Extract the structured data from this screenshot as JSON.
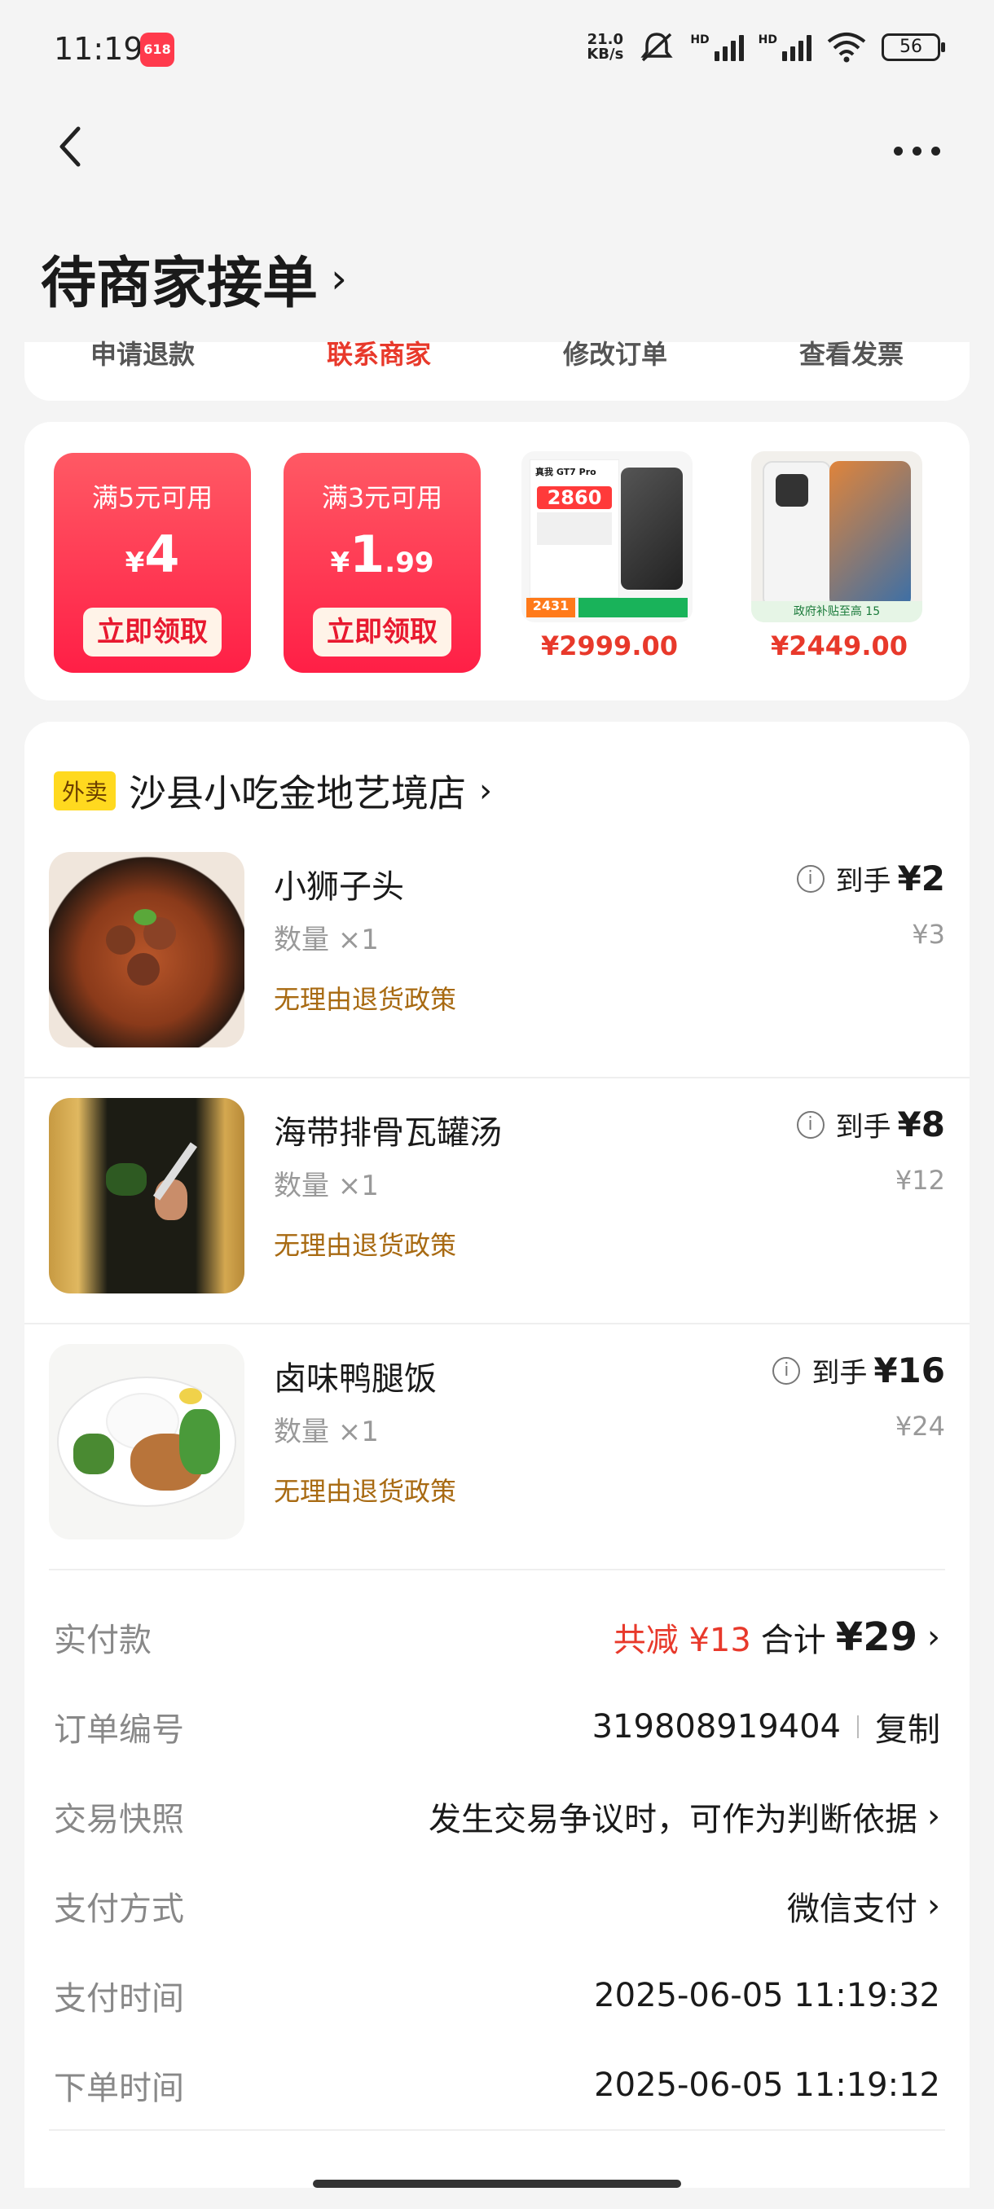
{
  "status_bar": {
    "time": "11:19",
    "app_badge": "618",
    "net_speed_top": "21.0",
    "net_speed_bottom": "KB/s",
    "hd1": "HD",
    "hd2": "HD",
    "battery": "56"
  },
  "header": {
    "title": "待商家接单",
    "title_chevron": "›"
  },
  "actions": [
    {
      "label": "申请退款"
    },
    {
      "label": "联系商家"
    },
    {
      "label": "修改订单"
    },
    {
      "label": "查看发票"
    }
  ],
  "promo": {
    "coupons": [
      {
        "condition": "满5元可用",
        "currency": "¥",
        "amount": "4",
        "button": "立即领取"
      },
      {
        "condition": "满3元可用",
        "currency": "¥",
        "amount": "1",
        "amount_decimal": ".99",
        "button": "立即领取"
      }
    ],
    "products": [
      {
        "price": "¥2999.00",
        "img_text_1": "真我 GT7 Pro",
        "img_text_2": "2860",
        "img_text_3": "2431"
      },
      {
        "price": "¥2449.00",
        "img_text_1": "政府补贴至高 15"
      }
    ]
  },
  "order": {
    "shop_tag": "外卖",
    "shop_name": "沙县小吃金地艺境店",
    "shop_chevron": "›",
    "items": [
      {
        "name": "小狮子头",
        "qty": "数量 ×1",
        "policy": "无理由退货政策",
        "final_label": "到手",
        "final_price": "¥2",
        "orig_price": "¥3"
      },
      {
        "name": "海带排骨瓦罐汤",
        "qty": "数量 ×1",
        "policy": "无理由退货政策",
        "final_label": "到手",
        "final_price": "¥8",
        "orig_price": "¥12"
      },
      {
        "name": "卤味鸭腿饭",
        "qty": "数量 ×1",
        "policy": "无理由退货政策",
        "final_label": "到手",
        "final_price": "¥16",
        "orig_price": "¥24"
      }
    ],
    "summary": {
      "paid_label": "实付款",
      "discount": "共减 ¥13",
      "total_label": "合计",
      "total": "¥29",
      "order_no_label": "订单编号",
      "order_no": "319808919404",
      "copy": "复制",
      "snapshot_label": "交易快照",
      "snapshot_value": "发生交易争议时，可作为判断依据",
      "pay_method_label": "支付方式",
      "pay_method": "微信支付",
      "pay_time_label": "支付时间",
      "pay_time": "2025-06-05 11:19:32",
      "order_time_label": "下单时间",
      "order_time": "2025-06-05 11:19:12",
      "chevron": "›"
    }
  },
  "colors": {
    "accent_red": "#e8392b",
    "coupon_red": "#ff1f46",
    "policy_brown": "#a86a12",
    "tag_yellow": "#ffd91f"
  }
}
